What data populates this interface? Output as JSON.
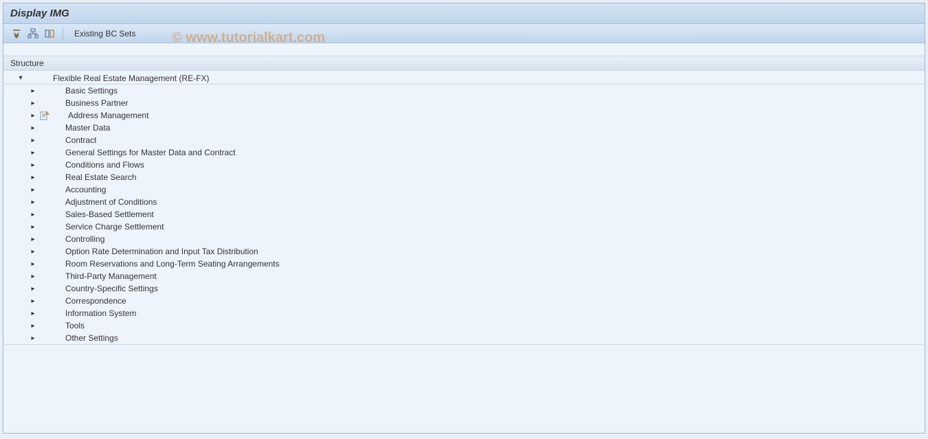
{
  "title_bar": {
    "title": "Display IMG"
  },
  "toolbar": {
    "existing_bc_sets": "Existing BC Sets"
  },
  "structure_header": "Structure",
  "tree": {
    "root_label": "Flexible Real Estate Management (RE-FX)",
    "children": [
      {
        "label": "Basic Settings",
        "has_activity_icon": false
      },
      {
        "label": "Business Partner",
        "has_activity_icon": false
      },
      {
        "label": "Address Management",
        "has_activity_icon": true
      },
      {
        "label": "Master Data",
        "has_activity_icon": false
      },
      {
        "label": "Contract",
        "has_activity_icon": false
      },
      {
        "label": "General Settings for Master Data and Contract",
        "has_activity_icon": false
      },
      {
        "label": "Conditions and Flows",
        "has_activity_icon": false
      },
      {
        "label": "Real Estate Search",
        "has_activity_icon": false
      },
      {
        "label": "Accounting",
        "has_activity_icon": false
      },
      {
        "label": "Adjustment of Conditions",
        "has_activity_icon": false
      },
      {
        "label": "Sales-Based Settlement",
        "has_activity_icon": false
      },
      {
        "label": "Service Charge Settlement",
        "has_activity_icon": false
      },
      {
        "label": "Controlling",
        "has_activity_icon": false
      },
      {
        "label": "Option Rate Determination and Input Tax Distribution",
        "has_activity_icon": false
      },
      {
        "label": "Room Reservations and Long-Term Seating Arrangements",
        "has_activity_icon": false
      },
      {
        "label": "Third-Party Management",
        "has_activity_icon": false
      },
      {
        "label": "Country-Specific Settings",
        "has_activity_icon": false
      },
      {
        "label": "Correspondence",
        "has_activity_icon": false
      },
      {
        "label": "Information System",
        "has_activity_icon": false
      },
      {
        "label": "Tools",
        "has_activity_icon": false
      },
      {
        "label": "Other Settings",
        "has_activity_icon": false
      }
    ]
  },
  "watermark": "© www.tutorialkart.com"
}
